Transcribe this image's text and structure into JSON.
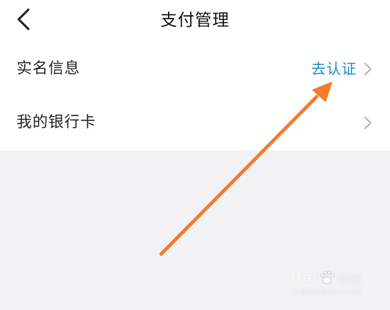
{
  "header": {
    "title": "支付管理",
    "back_icon": "chevron-left-icon"
  },
  "rows": [
    {
      "label": "实名信息",
      "action": "去认证",
      "chevron_icon": "chevron-right-icon"
    },
    {
      "label": "我的银行卡",
      "chevron_icon": "chevron-right-icon"
    }
  ],
  "colors": {
    "accent": "#1c8bd4",
    "background": "#f2f2f4",
    "surface": "#ffffff",
    "annotation_arrow": "#f47b2a",
    "chevron": "#b3b3b8"
  },
  "watermark": {
    "logo_prefix": "Bai",
    "logo_suffix": "经验",
    "url": "jingyan.baidu.com"
  }
}
